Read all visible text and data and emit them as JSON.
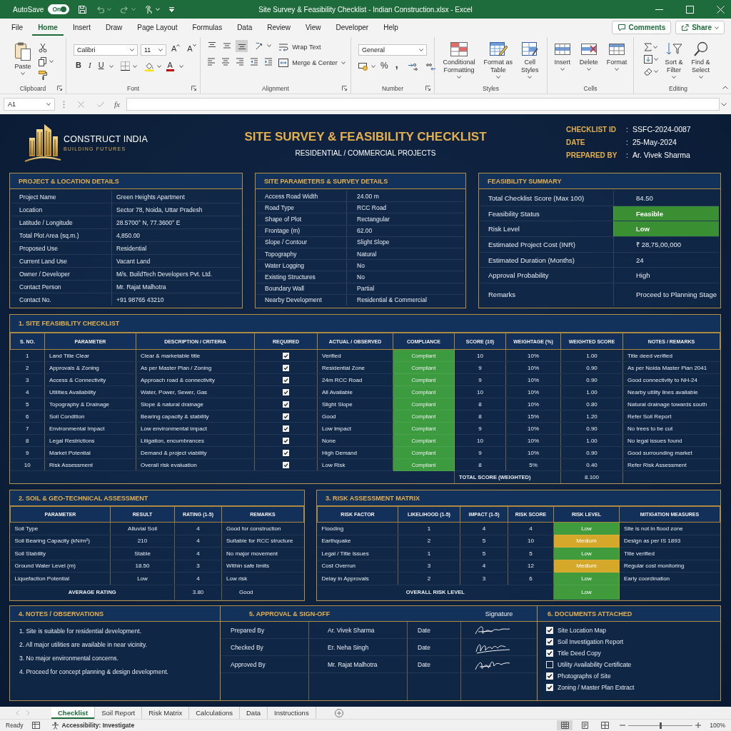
{
  "window": {
    "title": "Site Survey & Feasibility Checklist - Indian Construction.xlsx - Excel",
    "autosave": {
      "label": "AutoSave",
      "on": true,
      "state_label": "On"
    }
  },
  "menu": {
    "tabs": [
      {
        "label": "File",
        "selected": false
      },
      {
        "label": "Home",
        "selected": true
      },
      {
        "label": "Insert",
        "selected": false
      },
      {
        "label": "Draw",
        "selected": false
      },
      {
        "label": "Page Layout",
        "selected": false
      },
      {
        "label": "Formulas",
        "selected": false
      },
      {
        "label": "Data",
        "selected": false
      },
      {
        "label": "Review",
        "selected": false
      },
      {
        "label": "View",
        "selected": false
      },
      {
        "label": "Developer",
        "selected": false
      },
      {
        "label": "Help",
        "selected": false
      }
    ],
    "comments": "Comments",
    "share": "Share"
  },
  "ribbon": {
    "clipboard": {
      "paste": "Paste",
      "label": "Clipboard"
    },
    "font": {
      "name": "Calibri",
      "size": "11",
      "grow": "A",
      "shrink": "A",
      "bold": "B",
      "italic": "I",
      "underline": "U",
      "color_letter": "A",
      "label": "Font"
    },
    "alignment": {
      "vertical": [
        {
          "selected": false
        },
        {
          "selected": false
        },
        {
          "selected": true
        }
      ],
      "wrap": "Wrap Text",
      "merge": "Merge & Center",
      "label": "Alignment"
    },
    "number": {
      "format": "General",
      "percent": "%",
      "comma": ",",
      "label": "Number"
    },
    "styles": {
      "conditional": [
        "Conditional",
        "Formatting"
      ],
      "format_table": [
        "Format as",
        "Table"
      ],
      "cell_styles": [
        "Cell",
        "Styles"
      ],
      "label": "Styles"
    },
    "cells": {
      "insert": "Insert",
      "delete": "Delete",
      "format": "Format",
      "label": "Cells"
    },
    "editing": {
      "sort": [
        "Sort &",
        "Filter"
      ],
      "find": [
        "Find &",
        "Select"
      ],
      "label": "Editing"
    }
  },
  "formula_bar": {
    "name_box": "A1",
    "fx": "fx"
  },
  "sheet": {
    "header": {
      "company": "CONSTRUCT INDIA",
      "tagline": "BUILDING FUTURES",
      "title": "SITE SURVEY & FEASIBILITY CHECKLIST",
      "subtitle": "RESIDENTIAL / COMMERCIAL PROJECTS",
      "meta": [
        {
          "label": "CHECKLIST ID",
          "separator": ":",
          "value": "SSFC-2024-0087"
        },
        {
          "label": "DATE",
          "separator": ":",
          "value": "25-May-2024"
        },
        {
          "label": "PREPARED BY",
          "separator": ":",
          "value": "Ar. Vivek Sharma"
        }
      ]
    },
    "project_details": {
      "title": "PROJECT & LOCATION DETAILS",
      "rows": [
        {
          "label": "Project Name",
          "value": "Green Heights Apartment"
        },
        {
          "label": "Location",
          "value": "Sector 78, Noida, Uttar Pradesh"
        },
        {
          "label": "Latitude / Longitude",
          "value": "28.5700° N, 77.3600° E"
        },
        {
          "label": "Total Plot Area (sq.m.)",
          "value": "4,850.00"
        },
        {
          "label": "Proposed Use",
          "value": "Residential"
        },
        {
          "label": "Current Land Use",
          "value": "Vacant Land"
        },
        {
          "label": "Owner / Developer",
          "value": "M/s. BuildTech Developers Pvt. Ltd."
        },
        {
          "label": "Contact Person",
          "value": "Mr. Rajat Malhotra"
        },
        {
          "label": "Contact No.",
          "value": "+91 98765 43210"
        }
      ]
    },
    "site_parameters": {
      "title": "SITE PARAMETERS & SURVEY DETAILS",
      "rows": [
        {
          "label": "Access Road Width",
          "value": "24.00 m"
        },
        {
          "label": "Road Type",
          "value": "RCC Road"
        },
        {
          "label": "Shape of Plot",
          "value": "Rectangular"
        },
        {
          "label": "Frontage (m)",
          "value": "62.00"
        },
        {
          "label": "Slope / Contour",
          "value": "Slight Slope"
        },
        {
          "label": "Topography",
          "value": "Natural"
        },
        {
          "label": "Water Logging",
          "value": "No"
        },
        {
          "label": "Existing Structures",
          "value": "No"
        },
        {
          "label": "Boundary Wall",
          "value": "Partial"
        },
        {
          "label": "Nearby Development",
          "value": "Residential & Commercial"
        }
      ]
    },
    "feasibility_summary": {
      "title": "FEASIBILITY SUMMARY",
      "rows": [
        {
          "label": "Total Checklist Score (Max 100)",
          "value": "84.50",
          "highlighted": false
        },
        {
          "label": "Feasibility Status",
          "value": "Feasible",
          "highlighted": true
        },
        {
          "label": "Risk Level",
          "value": "Low",
          "highlighted": true
        },
        {
          "label": "Estimated Project Cost (INR)",
          "value": "₹ 28,75,00,000",
          "highlighted": false
        },
        {
          "label": "Estimated Duration (Months)",
          "value": "24",
          "highlighted": false
        },
        {
          "label": "Approval Probability",
          "value": "High",
          "highlighted": false
        },
        {
          "label": "Remarks",
          "value": "Proceed to Planning Stage",
          "highlighted": false
        }
      ]
    },
    "checklist": {
      "title": "1. SITE FEASIBILITY CHECKLIST",
      "columns": [
        "S. NO.",
        "PARAMETER",
        "DESCRIPTION / CRITERIA",
        "REQUIRED",
        "ACTUAL / OBSERVED",
        "COMPLIANCE",
        "SCORE (10)",
        "WEIGHTAGE (%)",
        "WEIGHTED SCORE",
        "NOTES / REMARKS"
      ],
      "rows": [
        {
          "no": "1",
          "parameter": "Land Title Clear",
          "description": "Clear & marketable title",
          "required": true,
          "actual": "Verified",
          "compliance": "Compliant",
          "compliant": true,
          "score": "10",
          "weightage": "10%",
          "weighted_score": "1.00",
          "notes": "Title deed verified"
        },
        {
          "no": "2",
          "parameter": "Approvals & Zoning",
          "description": "As per Master Plan / Zoning",
          "required": true,
          "actual": "Residential Zone",
          "compliance": "Compliant",
          "compliant": true,
          "score": "9",
          "weightage": "10%",
          "weighted_score": "0.90",
          "notes": "As per Noida Master Plan 2041"
        },
        {
          "no": "3",
          "parameter": "Access & Connectivity",
          "description": "Approach road & connectivity",
          "required": true,
          "actual": "24m RCC Road",
          "compliance": "Compliant",
          "compliant": true,
          "score": "9",
          "weightage": "10%",
          "weighted_score": "0.90",
          "notes": "Good connectivity to NH-24"
        },
        {
          "no": "4",
          "parameter": "Utilities Availability",
          "description": "Water, Power, Sewer, Gas",
          "required": true,
          "actual": "All Available",
          "compliance": "Compliant",
          "compliant": true,
          "score": "10",
          "weightage": "10%",
          "weighted_score": "1.00",
          "notes": "Nearby utility lines available"
        },
        {
          "no": "5",
          "parameter": "Topography & Drainage",
          "description": "Slope & natural drainage",
          "required": true,
          "actual": "Slight Slope",
          "compliance": "Compliant",
          "compliant": true,
          "score": "8",
          "weightage": "10%",
          "weighted_score": "0.80",
          "notes": "Natural drainage towards south"
        },
        {
          "no": "6",
          "parameter": "Soil Condition",
          "description": "Bearing capacity & stability",
          "required": true,
          "actual": "Good",
          "compliance": "Compliant",
          "compliant": true,
          "score": "8",
          "weightage": "15%",
          "weighted_score": "1.20",
          "notes": "Refer Soil Report"
        },
        {
          "no": "7",
          "parameter": "Environmental Impact",
          "description": "Low environmental impact",
          "required": true,
          "actual": "Low Impact",
          "compliance": "Compliant",
          "compliant": true,
          "score": "9",
          "weightage": "10%",
          "weighted_score": "0.90",
          "notes": "No trees to be cut"
        },
        {
          "no": "8",
          "parameter": "Legal Restrictions",
          "description": "Litigation, encumbrances",
          "required": true,
          "actual": "None",
          "compliance": "Compliant",
          "compliant": true,
          "score": "10",
          "weightage": "10%",
          "weighted_score": "1.00",
          "notes": "No legal issues found"
        },
        {
          "no": "9",
          "parameter": "Market Potential",
          "description": "Demand & project viability",
          "required": true,
          "actual": "High Demand",
          "compliance": "Compliant",
          "compliant": true,
          "score": "9",
          "weightage": "10%",
          "weighted_score": "0.90",
          "notes": "Good surrounding market"
        },
        {
          "no": "10",
          "parameter": "Risk Assessment",
          "description": "Overall risk evaluation",
          "required": true,
          "actual": "Low Risk",
          "compliance": "Compliant",
          "compliant": true,
          "score": "8",
          "weightage": "5%",
          "weighted_score": "0.40",
          "notes": "Refer Risk Assessment"
        }
      ],
      "total_label": "TOTAL SCORE (WEIGHTED)",
      "total_value": "8.100"
    },
    "soil": {
      "title": "2. SOIL & GEO-TECHNICAL ASSESSMENT",
      "columns": [
        "PARAMETER",
        "RESULT",
        "RATING (1-5)",
        "REMARKS"
      ],
      "rows": [
        {
          "parameter": "Soil Type",
          "result": "Alluvial Soil",
          "rating": "4",
          "remarks": "Good for construction"
        },
        {
          "parameter": "Soil Bearing Capacity (kN/m²)",
          "result": "210",
          "rating": "4",
          "remarks": "Suitable for RCC structure"
        },
        {
          "parameter": "Soil Stability",
          "result": "Stable",
          "rating": "4",
          "remarks": "No major movement"
        },
        {
          "parameter": "Ground Water Level (m)",
          "result": "18.50",
          "rating": "3",
          "remarks": "Within safe limits"
        },
        {
          "parameter": "Liquefaction Potential",
          "result": "Low",
          "rating": "4",
          "remarks": "Low risk"
        }
      ],
      "footer": {
        "label": "AVERAGE RATING",
        "rating": "3.80",
        "remarks": "Good"
      }
    },
    "risk": {
      "title": "3. RISK ASSESSMENT MATRIX",
      "columns": [
        "RISK FACTOR",
        "LIKELIHOOD (1-5)",
        "IMPACT (1-5)",
        "RISK SCORE",
        "RISK LEVEL",
        "MITIGATION MEASURES"
      ],
      "rows": [
        {
          "factor": "Flooding",
          "likelihood": "1",
          "impact": "4",
          "score": "4",
          "level": "Low",
          "color": "#3f9b3c",
          "mitigation": "Site is not in flood zone"
        },
        {
          "factor": "Earthquake",
          "likelihood": "2",
          "impact": "5",
          "score": "10",
          "level": "Medium",
          "color": "#d6a82a",
          "mitigation": "Design as per IS 1893"
        },
        {
          "factor": "Legal / Title Issues",
          "likelihood": "1",
          "impact": "5",
          "score": "5",
          "level": "Low",
          "color": "#3f9b3c",
          "mitigation": "Title verified"
        },
        {
          "factor": "Cost Overrun",
          "likelihood": "3",
          "impact": "4",
          "score": "12",
          "level": "Medium",
          "color": "#d6a82a",
          "mitigation": "Regular cost monitoring"
        },
        {
          "factor": "Delay in Approvals",
          "likelihood": "2",
          "impact": "3",
          "score": "6",
          "level": "Low",
          "color": "#3f9b3c",
          "mitigation": "Early coordination"
        }
      ],
      "footer": {
        "label": "OVERALL RISK LEVEL",
        "level": "Low",
        "color": "#3f9b3c"
      }
    },
    "notes": {
      "title": "4. NOTES / OBSERVATIONS",
      "items": [
        "1. Site is suitable for residential development.",
        "2. All major utilities are available in near vicinity.",
        "3. No major environmental concerns.",
        "4. Proceed for concept planning & design development."
      ]
    },
    "approval": {
      "title": "5. APPROVAL & SIGN-OFF",
      "signature_heading": "Signature",
      "rows": [
        {
          "role": "Prepared By",
          "name": "Ar. Vivek Sharma",
          "date_label": "Date"
        },
        {
          "role": "Checked By",
          "name": "Er. Neha Singh",
          "date_label": "Date"
        },
        {
          "role": "Approved By",
          "name": "Mr. Rajat Malhotra",
          "date_label": "Date"
        }
      ]
    },
    "documents": {
      "title": "6. DOCUMENTS ATTACHED",
      "items": [
        {
          "label": "Site Location Map",
          "checked": true
        },
        {
          "label": "Soil Investigation Report",
          "checked": true
        },
        {
          "label": "Title Deed Copy",
          "checked": true
        },
        {
          "label": "Utility Availability Certificate",
          "checked": false
        },
        {
          "label": "Photographs of Site",
          "checked": true
        },
        {
          "label": "Zoning / Master Plan Extract",
          "checked": true
        }
      ]
    }
  },
  "sheet_tabs": [
    {
      "label": "Checklist",
      "selected": true
    },
    {
      "label": "Soil Report",
      "selected": false
    },
    {
      "label": "Risk Matrix",
      "selected": false
    },
    {
      "label": "Calculations",
      "selected": false
    },
    {
      "label": "Data",
      "selected": false
    },
    {
      "label": "Instructions",
      "selected": false
    }
  ],
  "status_bar": {
    "mode": "Ready",
    "accessibility": "Accessibility: Investigate",
    "views": [
      {
        "selected": true
      },
      {
        "selected": false
      },
      {
        "selected": false
      }
    ],
    "zoom_slider": {
      "level": 0.5
    },
    "zoom": "100%"
  }
}
